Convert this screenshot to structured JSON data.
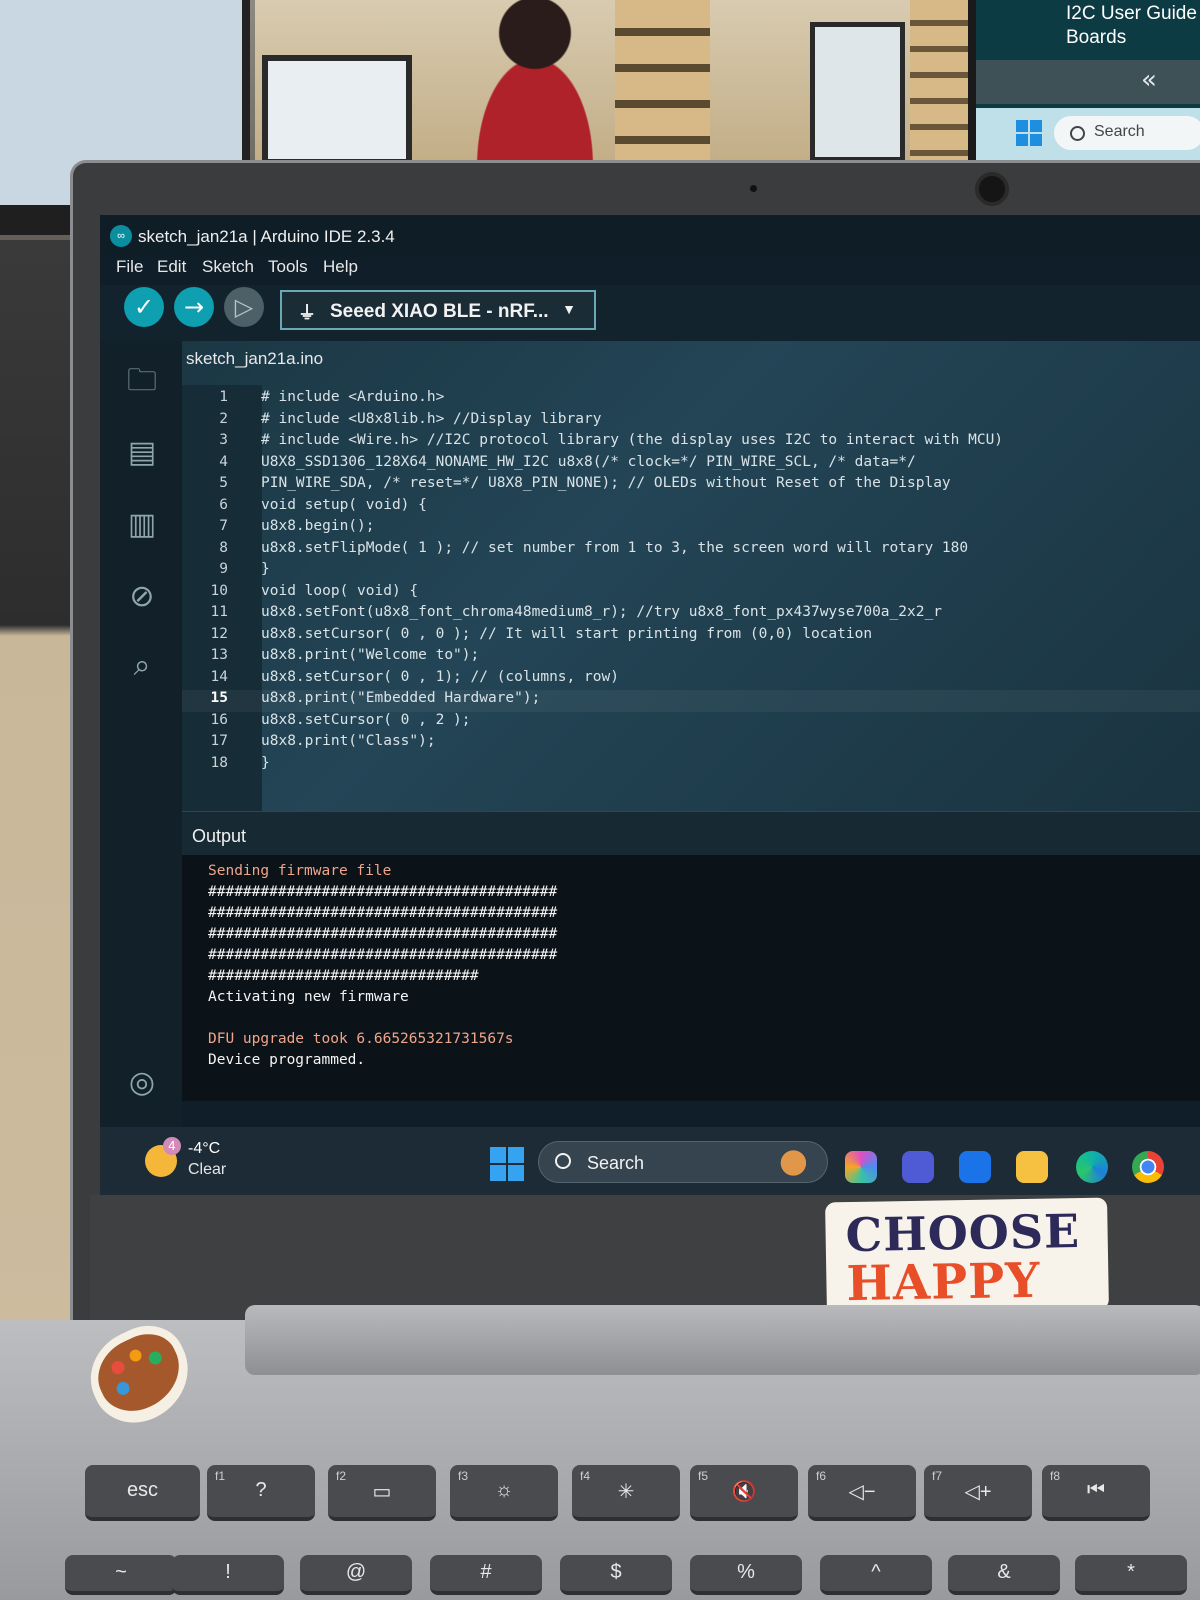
{
  "background": {
    "right_monitor_title": "I2C User Guide\nBoards",
    "right_monitor_chevron": "«",
    "right_monitor_search": "Search"
  },
  "window": {
    "title": "sketch_jan21a | Arduino IDE 2.3.4",
    "logo_glyph": "∞"
  },
  "menu": [
    "File",
    "Edit",
    "Sketch",
    "Tools",
    "Help"
  ],
  "toolbar": {
    "verify_icon": "check-icon",
    "upload_icon": "arrow-right-icon",
    "debug_icon": "debug-icon",
    "board": "Seeed XIAO BLE - nRF...",
    "board_icon": "usb-icon"
  },
  "sidebar_icons": [
    "folder-icon",
    "boards-manager-icon",
    "library-icon",
    "debug-off-icon",
    "search-icon",
    "account-icon"
  ],
  "editor": {
    "tab": "sketch_jan21a.ino",
    "active_line": 15,
    "lines": [
      {
        "n": "1",
        "text": "# include <Arduino.h>"
      },
      {
        "n": "2",
        "text": "# include <U8x8lib.h> //Display library"
      },
      {
        "n": "3",
        "text": "# include <Wire.h> //I2C protocol library (the display uses I2C to interact with MCU)"
      },
      {
        "n": "4",
        "text": "U8X8_SSD1306_128X64_NONAME_HW_I2C u8x8(/* clock=*/ PIN_WIRE_SCL, /* data=*/"
      },
      {
        "n": "5",
        "text": "PIN_WIRE_SDA, /* reset=*/ U8X8_PIN_NONE); // OLEDs without Reset of the Display"
      },
      {
        "n": "6",
        "text": "void setup( void) {"
      },
      {
        "n": "7",
        "text": "u8x8.begin();"
      },
      {
        "n": "8",
        "text": "u8x8.setFlipMode( 1 ); // set number from 1 to 3, the screen word will rotary 180"
      },
      {
        "n": "9",
        "text": "}"
      },
      {
        "n": "10",
        "text": "void loop( void) {"
      },
      {
        "n": "11",
        "text": "u8x8.setFont(u8x8_font_chroma48medium8_r); //try u8x8_font_px437wyse700a_2x2_r"
      },
      {
        "n": "12",
        "text": "u8x8.setCursor( 0 , 0 ); // It will start printing from (0,0) location"
      },
      {
        "n": "13",
        "text": "u8x8.print(\"Welcome to\");"
      },
      {
        "n": "14",
        "text": "u8x8.setCursor( 0 , 1); // (columns, row)"
      },
      {
        "n": "15",
        "text": "u8x8.print(\"Embedded Hardware\");"
      },
      {
        "n": "16",
        "text": "u8x8.setCursor( 0 , 2 );"
      },
      {
        "n": "17",
        "text": "u8x8.print(\"Class\");"
      },
      {
        "n": "18",
        "text": "}"
      }
    ]
  },
  "output": {
    "title": "Output",
    "lines": [
      {
        "text": "Sending firmware file",
        "color": "orange"
      },
      {
        "text": "########################################",
        "color": "white"
      },
      {
        "text": "########################################",
        "color": "white"
      },
      {
        "text": "########################################",
        "color": "white"
      },
      {
        "text": "########################################",
        "color": "white"
      },
      {
        "text": "###############################",
        "color": "white"
      },
      {
        "text": "Activating new firmware",
        "color": "white"
      },
      {
        "text": "",
        "color": "white"
      },
      {
        "text": "DFU upgrade took 6.665265321731567s",
        "color": "orange"
      },
      {
        "text": "Device programmed.",
        "color": "white"
      }
    ]
  },
  "taskbar": {
    "weather_badge": "4",
    "temperature": "-4°C",
    "condition": "Clear",
    "search_placeholder": "Search",
    "apps": [
      "copilot-icon",
      "teams-icon",
      "mail-icon",
      "file-explorer-icon",
      "edge-icon",
      "chrome-icon"
    ]
  },
  "stickers": {
    "line1": "CHOOSE",
    "line2": "HAPPY"
  },
  "keyboard": {
    "fn_row": [
      {
        "fn": "",
        "main": "esc"
      },
      {
        "fn": "f1",
        "main": "?"
      },
      {
        "fn": "f2",
        "main": "▭"
      },
      {
        "fn": "f3",
        "main": "☼"
      },
      {
        "fn": "f4",
        "main": "✳"
      },
      {
        "fn": "f5",
        "main": "🔇"
      },
      {
        "fn": "f6",
        "main": "◁−"
      },
      {
        "fn": "f7",
        "main": "◁+"
      },
      {
        "fn": "f8",
        "main": "⏮"
      }
    ],
    "num_row": [
      "~",
      "!",
      "@",
      "#",
      "$",
      "%",
      "^",
      "&",
      "*"
    ]
  },
  "colors": {
    "accent": "#0e9fb1",
    "editor_bg": "#1b3744",
    "output_orange": "#f0a58a"
  }
}
